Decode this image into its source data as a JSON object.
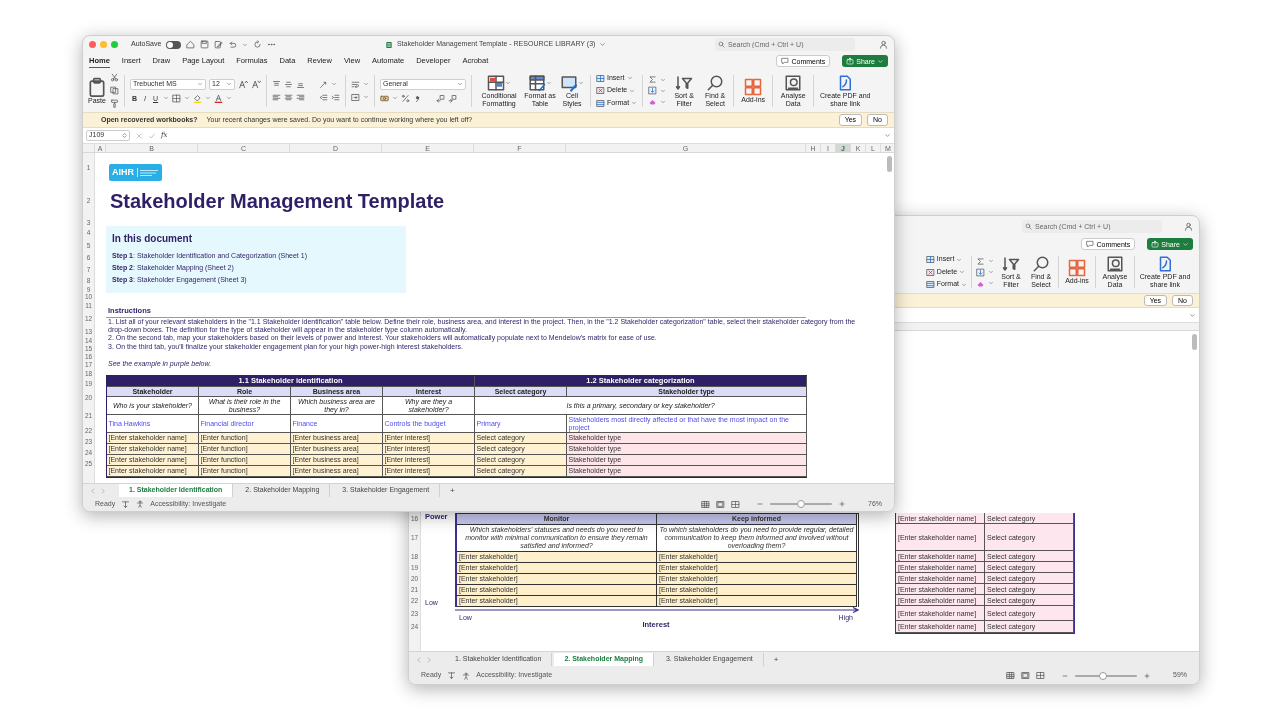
{
  "front_window": {
    "autosave": {
      "label": "AutoSave",
      "on": false
    },
    "title": "Stakeholder Management Template - RESOURCE LIBRARY (3)",
    "search": {
      "placeholder": "Search (Cmd + Ctrl + U)"
    },
    "menu_tabs": [
      {
        "label": "Home",
        "selected": true
      },
      {
        "label": "Insert",
        "selected": false
      },
      {
        "label": "Draw",
        "selected": false
      },
      {
        "label": "Page Layout",
        "selected": false
      },
      {
        "label": "Formulas",
        "selected": false
      },
      {
        "label": "Data",
        "selected": false
      },
      {
        "label": "Review",
        "selected": false
      },
      {
        "label": "View",
        "selected": false
      },
      {
        "label": "Automate",
        "selected": false
      },
      {
        "label": "Developer",
        "selected": false
      },
      {
        "label": "Acrobat",
        "selected": false
      }
    ],
    "comments_button": "Comments",
    "share_button": "Share",
    "ribbon": {
      "paste": "Paste",
      "font": "Trebuchet MS",
      "font_size": "12",
      "bold": "B",
      "italic": "I",
      "underline": "U",
      "number_format": "General",
      "large_buttons": [
        "Conditional Formatting",
        "Format as Table",
        "Cell Styles"
      ],
      "cell_buttons": [
        "Insert",
        "Delete",
        "Format"
      ],
      "tool_buttons": [
        "Sort & Filter",
        "Find & Select",
        "Add-ins",
        "Analyse Data",
        "Create PDF and share link"
      ]
    },
    "notification": {
      "title": "Open recovered workbooks?",
      "message": "Your recent changes were saved. Do you want to continue working where you left off?",
      "buttons": [
        "Yes",
        "No"
      ]
    },
    "name_box": "J109",
    "formula_label": "fx",
    "columns": [
      {
        "label": "A",
        "selected": false
      },
      {
        "label": "B",
        "selected": false
      },
      {
        "label": "C",
        "selected": false
      },
      {
        "label": "D",
        "selected": false
      },
      {
        "label": "E",
        "selected": false
      },
      {
        "label": "F",
        "selected": false
      },
      {
        "label": "G",
        "selected": false
      },
      {
        "label": "H",
        "selected": false
      },
      {
        "label": "I",
        "selected": false
      },
      {
        "label": "J",
        "selected": true
      },
      {
        "label": "K",
        "selected": false
      },
      {
        "label": "L",
        "selected": false
      },
      {
        "label": "M",
        "selected": false
      }
    ],
    "row_numbers": [
      "1",
      "2",
      "3",
      "4",
      "5",
      "6",
      "7",
      "8",
      "9",
      "10",
      "11",
      "12",
      "13",
      "14",
      "15",
      "16",
      "17",
      "18",
      "19",
      "20",
      "21",
      "22",
      "23",
      "24",
      "25"
    ],
    "sheet": {
      "logo": "AIHR",
      "title": "Stakeholder Management Template",
      "contents": {
        "heading": "In this document",
        "steps": [
          "**Step 1**: Stakeholder Identification and Categorization (Sheet 1)",
          "**Step 2**: Stakeholder Mapping (Sheet 2)",
          "**Step 3**: Stakeholder Engagement (Sheet 3)"
        ]
      },
      "instructions": {
        "heading": "Instructions",
        "items": [
          "1. List all of your relevant stakeholders in the \"1.1 Stakeholder identification\" table below. Define their role, business area, and interest in the project. Then, in the \"1.2 Stakeholder categorization\" table, select their stakeholder category from the drop-down boxes. The definition for the type of stakeholder will appear in the stakeholder type column automatically.",
          "2. On the second tab, map your stakeholders based on their levels of power and interest. Your stakeholders will automatically populate next to Mendelow's matrix for ease of use.",
          "3. On the third tab, you'll finalize your stakeholder engagement plan for your high power-high interest stakeholders."
        ],
        "note": "See the example in purple below."
      },
      "table": {
        "groups": [
          "1.1 Stakeholder identification",
          "1.2 Stakeholder categorization"
        ],
        "columns": [
          "Stakeholder",
          "Role",
          "Business area",
          "Interest",
          "Select category",
          "Stakeholder type"
        ],
        "prompts": [
          "Who is your stakeholder?",
          "What is their role in the business?",
          "Which business area are they in?",
          "Why are they a stakeholder?",
          "Is this a primary, secondary or key stakeholder?"
        ],
        "example": [
          "Tina Hawkins",
          "Financial director",
          "Finance",
          "Controls the budget",
          "Primary",
          "Stakeholders most directly affected or that have the most impact on the project"
        ],
        "rows": [
          [
            "[Enter stakeholder name]",
            "[Enter function]",
            "[Enter business area]",
            "[Enter interest]",
            "Select category",
            "Stakeholder type"
          ],
          [
            "[Enter stakeholder name]",
            "[Enter function]",
            "[Enter business area]",
            "[Enter interest]",
            "Select category",
            "Stakeholder type"
          ],
          [
            "[Enter stakeholder name]",
            "[Enter function]",
            "[Enter business area]",
            "[Enter interest]",
            "Select category",
            "Stakeholder type"
          ],
          [
            "[Enter stakeholder name]",
            "[Enter function]",
            "[Enter business area]",
            "[Enter interest]",
            "Select category",
            "Stakeholder type"
          ]
        ]
      }
    },
    "sheet_tabs": [
      {
        "label": "1. Stakeholder Identification",
        "selected": true
      },
      {
        "label": "2. Stakeholder Mapping",
        "selected": false
      },
      {
        "label": "3. Stakeholder Engagement",
        "selected": false
      }
    ],
    "add_sheet": "+",
    "status": {
      "ready": "Ready",
      "accessibility": "Accessibility: Investigate",
      "zoom": {
        "level": 0.5,
        "reading": "76%"
      }
    }
  },
  "back_window": {
    "search": {
      "placeholder": "Search (Cmd + Ctrl + U)"
    },
    "comments_button": "Comments",
    "share_button": "Share",
    "ribbon": {
      "cell_buttons": [
        "Insert",
        "Delete",
        "Format"
      ],
      "tool_buttons": [
        "Sort & Filter",
        "Find & Select",
        "Add-ins",
        "Analyse Data",
        "Create PDF and share link"
      ]
    },
    "notification": {
      "buttons": [
        "Yes",
        "No"
      ]
    },
    "row_numbers": [
      "16",
      "17",
      "18",
      "19",
      "20",
      "21",
      "22",
      "23",
      "24"
    ],
    "matrix": {
      "y_label": "Power",
      "y_low": "Low",
      "columns": [
        "Monitor",
        "Keep informed"
      ],
      "prompts": [
        "Which stakeholders' statuses and needs do you need to monitor with minimal communication to ensure they remain satisfied and informed?",
        "To which stakeholders do you need to provide regular, detailed communication to keep them informed and involved without overloading them?"
      ],
      "rows": [
        [
          "[Enter stakeholder]",
          "[Enter stakeholder]"
        ],
        [
          "[Enter stakeholder]",
          "[Enter stakeholder]"
        ],
        [
          "[Enter stakeholder]",
          "[Enter stakeholder]"
        ],
        [
          "[Enter stakeholder]",
          "[Enter stakeholder]"
        ],
        [
          "[Enter stakeholder]",
          "[Enter stakeholder]"
        ]
      ],
      "x_low": "Low",
      "x_high": "High",
      "x_label": "Interest"
    },
    "list": {
      "rows": [
        [
          "[Enter stakeholder name]",
          "Select category"
        ],
        [
          "[Enter stakeholder name]",
          "Select category"
        ],
        [
          "[Enter stakeholder name]",
          "Select category"
        ],
        [
          "[Enter stakeholder name]",
          "Select category"
        ],
        [
          "[Enter stakeholder name]",
          "Select category"
        ],
        [
          "[Enter stakeholder name]",
          "Select category"
        ],
        [
          "[Enter stakeholder name]",
          "Select category"
        ],
        [
          "[Enter stakeholder name]",
          "Select category"
        ],
        [
          "[Enter stakeholder name]",
          "Select category"
        ]
      ]
    },
    "sheet_tabs": [
      {
        "label": "1. Stakeholder Identification",
        "selected": false
      },
      {
        "label": "2. Stakeholder Mapping",
        "selected": true
      },
      {
        "label": "3. Stakeholder Engagement",
        "selected": false
      }
    ],
    "add_sheet": "+",
    "status": {
      "ready": "Ready",
      "accessibility": "Accessibility: Investigate",
      "zoom": {
        "level": 0.45,
        "reading": "59%"
      }
    }
  }
}
